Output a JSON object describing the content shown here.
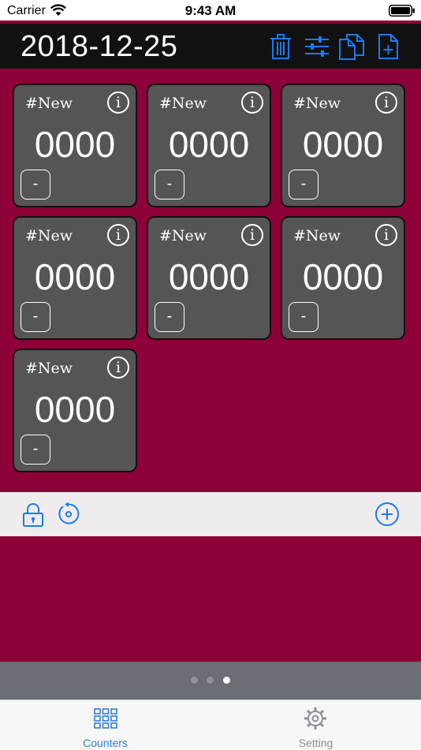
{
  "status": {
    "carrier": "Carrier",
    "time": "9:43 AM"
  },
  "header": {
    "date": "2018-12-25",
    "icons": [
      "trash-icon",
      "sliders-icon",
      "copy-icon",
      "new-file-icon"
    ]
  },
  "counters": [
    {
      "name": "#New",
      "value": "0000",
      "info": "i",
      "decrement": "-"
    },
    {
      "name": "#New",
      "value": "0000",
      "info": "i",
      "decrement": "-"
    },
    {
      "name": "#New",
      "value": "0000",
      "info": "i",
      "decrement": "-"
    },
    {
      "name": "#New",
      "value": "0000",
      "info": "i",
      "decrement": "-"
    },
    {
      "name": "#New",
      "value": "0000",
      "info": "i",
      "decrement": "-"
    },
    {
      "name": "#New",
      "value": "0000",
      "info": "i",
      "decrement": "-"
    },
    {
      "name": "#New",
      "value": "0000",
      "info": "i",
      "decrement": "-"
    }
  ],
  "toolbar": {
    "icons": [
      "lock-icon",
      "reset-icon",
      "add-circle-icon"
    ]
  },
  "pager": {
    "pages": 3,
    "current": 3
  },
  "tabs": [
    {
      "label": "Counters",
      "icon": "grid-icon",
      "active": true
    },
    {
      "label": "Setting",
      "icon": "gear-icon",
      "active": false
    }
  ],
  "colors": {
    "accent": "#8e0038",
    "header_bg": "#111111",
    "card_bg": "#555555",
    "ios_blue": "#1a7bf2",
    "tab_active": "#2f80d6",
    "tab_inactive": "#8e8e93"
  }
}
